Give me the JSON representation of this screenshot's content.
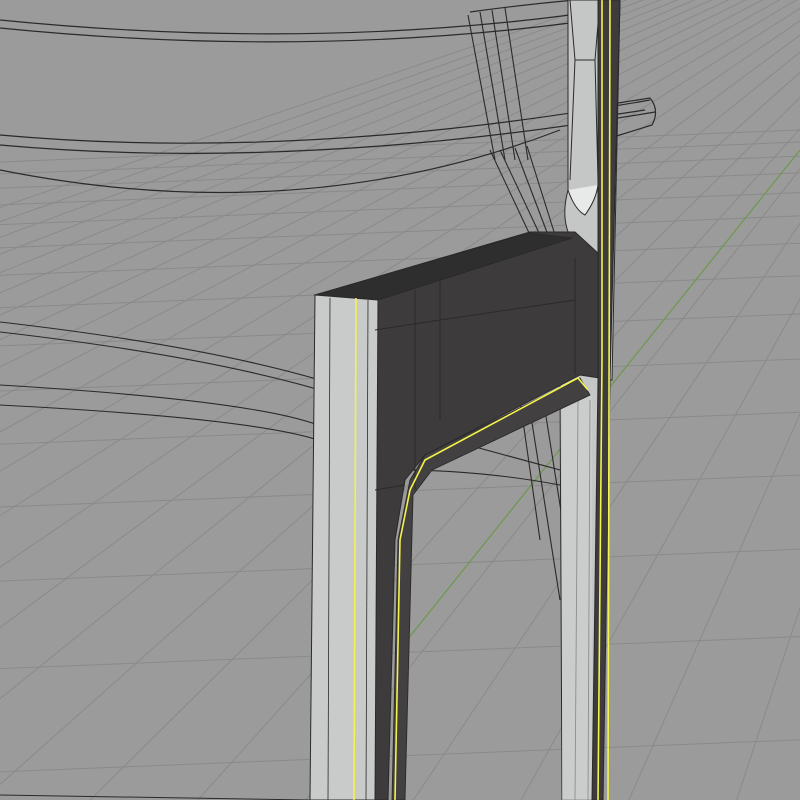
{
  "viewport": {
    "view": "perspective",
    "background_color": "#9b9b9b",
    "grid_line_color": "#8a8a8a",
    "axis_line_color": "#6f9a4e",
    "wireframe_color": "#2a2a2a",
    "selection_outline_color": "#f3f34a",
    "selected_face_color": "#3d3b3c",
    "model_surface_color": "#c7c9c8",
    "objects": [
      {
        "name": "back-slat-upper",
        "selected": false,
        "display": "wireframe"
      },
      {
        "name": "back-slat-lower",
        "selected": false,
        "display": "wireframe"
      },
      {
        "name": "seat-rail-far",
        "selected": false,
        "display": "wireframe"
      },
      {
        "name": "rear-post",
        "selected": false,
        "display": "shaded"
      },
      {
        "name": "side-frame-panel",
        "selected": true,
        "display": "shaded"
      }
    ]
  }
}
